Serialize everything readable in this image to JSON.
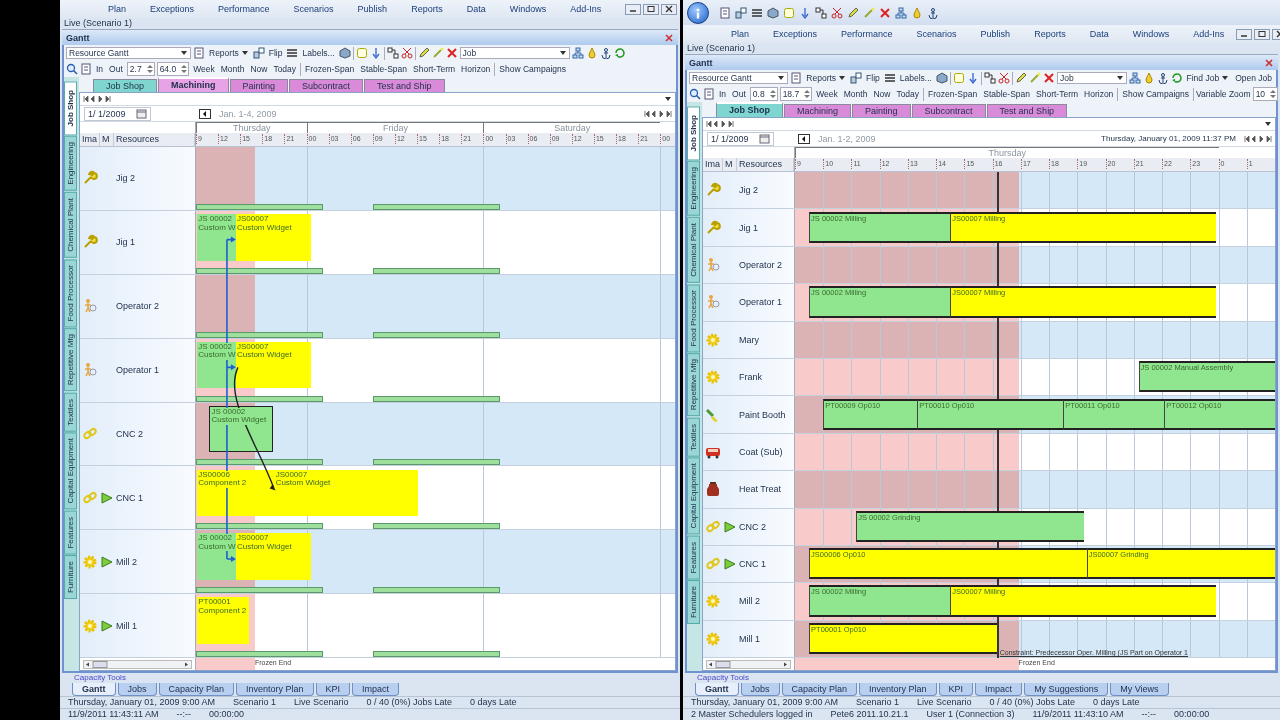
{
  "windows": [
    {
      "quick_access": false,
      "menu": [
        "Plan",
        "Exceptions",
        "Performance",
        "Scenarios",
        "Publish",
        "Reports",
        "Data",
        "Windows",
        "Add-Ins"
      ],
      "scenario": "Live (Scenario 1)",
      "panel_title": "Gantt",
      "toolbar": [
        [
          {
            "kind": "dropdown",
            "label": "Resource Gantt"
          },
          {
            "kind": "icon"
          },
          {
            "kind": "menu",
            "label": "Reports"
          },
          {
            "kind": "icon"
          },
          {
            "kind": "button",
            "label": "Flip"
          },
          {
            "kind": "icon"
          },
          {
            "kind": "button",
            "label": "Labels..."
          },
          {
            "kind": "icon"
          },
          {
            "kind": "sep"
          },
          {
            "kind": "icon"
          },
          {
            "kind": "icon"
          },
          {
            "kind": "sep"
          },
          {
            "kind": "icon"
          },
          {
            "kind": "icon"
          },
          {
            "kind": "sep"
          },
          {
            "kind": "icon"
          },
          {
            "kind": "icon"
          },
          {
            "kind": "icon"
          },
          {
            "kind": "dropdown",
            "label": "Job"
          },
          {
            "kind": "icon"
          },
          {
            "kind": "icon"
          },
          {
            "kind": "icon"
          },
          {
            "kind": "icon"
          }
        ],
        [
          {
            "kind": "icon"
          },
          {
            "kind": "icon"
          },
          {
            "kind": "button",
            "label": "In"
          },
          {
            "kind": "button",
            "label": "Out"
          },
          {
            "kind": "spin",
            "label": "2.7"
          },
          {
            "kind": "spin",
            "label": "64.0"
          },
          {
            "kind": "button",
            "label": "Week"
          },
          {
            "kind": "button",
            "label": "Month"
          },
          {
            "kind": "button",
            "label": "Now"
          },
          {
            "kind": "button",
            "label": "Today"
          },
          {
            "kind": "sep"
          },
          {
            "kind": "button",
            "label": "Frozen-Span"
          },
          {
            "kind": "button",
            "label": "Stable-Span"
          },
          {
            "kind": "button",
            "label": "Short-Term"
          },
          {
            "kind": "button",
            "label": "Horizon"
          },
          {
            "kind": "sep"
          },
          {
            "kind": "button",
            "label": "Show Campaigns"
          }
        ]
      ],
      "tabs": [
        {
          "label": "Job Shop",
          "color": "#7fd6d0",
          "selected": false
        },
        {
          "label": "Machining",
          "color": "#e7a3e6",
          "selected": true
        },
        {
          "label": "Painting",
          "color": "#d98ad8",
          "selected": false
        },
        {
          "label": "Subcontract",
          "color": "#d98ad8",
          "selected": false
        },
        {
          "label": "Test and Ship",
          "color": "#d98ad8",
          "selected": false
        }
      ],
      "side_tabs": [
        {
          "label": "Job Shop",
          "selected": true
        },
        {
          "label": "Engineering",
          "selected": false
        },
        {
          "label": "Chemical Plant",
          "selected": false
        },
        {
          "label": "Food Processor",
          "selected": false
        },
        {
          "label": "Repetitive Mfg",
          "selected": false
        },
        {
          "label": "Textiles",
          "selected": false
        },
        {
          "label": "Capital Equipment",
          "selected": false
        },
        {
          "label": "Features",
          "selected": false
        },
        {
          "label": "Furniture",
          "selected": false
        }
      ],
      "gantt": {
        "date": "1/ 1/2009",
        "range": "Jan. 1-4, 2009",
        "columns": [
          "Ima",
          "M",
          "Resources"
        ],
        "days": [
          "Thursday",
          "Friday",
          "Saturday"
        ],
        "ticks": [
          "9",
          "12",
          "15",
          "18",
          "21",
          "00",
          "03",
          "06",
          "09",
          "12",
          "15",
          "18",
          "21",
          "00",
          "03",
          "06",
          "09",
          "12",
          "15",
          "18",
          "21",
          "00"
        ],
        "rows": [
          {
            "name": "Jig 2",
            "kind": "jig",
            "flag": false,
            "shaded": true,
            "bars": []
          },
          {
            "name": "Jig 1",
            "kind": "jig",
            "flag": false,
            "shaded": false,
            "bars": [
              {
                "lines": [
                  "JS 00002",
                  "Custom W"
                ],
                "color": "#8fe68f",
                "outlined": false,
                "kind": "plain"
              },
              {
                "lines": [
                  "JS00007",
                  "Custom Widget"
                ],
                "color": "#ffff00",
                "outlined": false,
                "kind": "elbow"
              }
            ]
          },
          {
            "name": "Operator 2",
            "kind": "operator",
            "flag": false,
            "shaded": true,
            "bars": []
          },
          {
            "name": "Operator 1",
            "kind": "operator",
            "flag": false,
            "shaded": false,
            "bars": [
              {
                "lines": [
                  "JS 00002",
                  "Custom W"
                ],
                "color": "#8fe68f",
                "outlined": false,
                "kind": "plain"
              },
              {
                "lines": [
                  "JS00007",
                  "Custom Widget"
                ],
                "color": "#ffff00",
                "outlined": false,
                "kind": "elbow"
              }
            ]
          },
          {
            "name": "CNC 2",
            "kind": "chain",
            "flag": false,
            "shaded": true,
            "bars": [
              {
                "lines": [
                  "JS 00002",
                  "Custom Widget"
                ],
                "color": "#8fe68f",
                "outlined": true,
                "kind": "plain"
              }
            ]
          },
          {
            "name": "CNC 1",
            "kind": "chain",
            "flag": true,
            "shaded": false,
            "bars": [
              {
                "lines": [
                  "JS00006",
                  "Component 2"
                ],
                "color": "#ffff00",
                "outlined": false,
                "kind": "plain"
              },
              {
                "lines": [
                  "JS00007",
                  "Custom Widget"
                ],
                "color": "#ffff00",
                "outlined": false,
                "kind": "curve"
              }
            ]
          },
          {
            "name": "Mill 2",
            "kind": "gear",
            "flag": true,
            "shaded": true,
            "bars": [
              {
                "lines": [
                  "JS 00002",
                  "Custom W"
                ],
                "color": "#8fe68f",
                "outlined": false,
                "kind": "plain"
              },
              {
                "lines": [
                  "JS00007",
                  "Custom Widget"
                ],
                "color": "#ffff00",
                "outlined": false,
                "kind": "elbow"
              }
            ]
          },
          {
            "name": "Mill 1",
            "kind": "gear",
            "flag": true,
            "shaded": false,
            "bars": [
              {
                "lines": [
                  "PT00001",
                  "Component 2"
                ],
                "color": "#ffff00",
                "outlined": false,
                "kind": "plain"
              }
            ]
          }
        ],
        "frozen_label": "Frozen End"
      },
      "tools_label": "Capacity Tools",
      "bottom_tabs": [
        {
          "label": "Gantt",
          "selected": true
        },
        {
          "label": "Jobs",
          "selected": false
        },
        {
          "label": "Capacity Plan",
          "selected": false
        },
        {
          "label": "Inventory Plan",
          "selected": false
        },
        {
          "label": "KPI",
          "selected": false
        },
        {
          "label": "Impact",
          "selected": false
        }
      ],
      "status": [
        [
          "Thursday, January 01, 2009 9:00 AM",
          "Scenario 1",
          "Live Scenario",
          "0 / 40 (0%) Jobs Late",
          "0 days Late"
        ],
        [
          "11/9/2011 11:43:11 AM",
          "--:--",
          "00:00:00"
        ]
      ]
    },
    {
      "quick_access": true,
      "menu": [
        "Plan",
        "Exceptions",
        "Performance",
        "Scenarios",
        "Publish",
        "Reports",
        "Data",
        "Windows",
        "Add-Ins"
      ],
      "scenario": "Live (Scenario 1)",
      "panel_title": "Gantt",
      "toolbar": [
        [
          {
            "kind": "dropdown",
            "label": "Resource Gantt"
          },
          {
            "kind": "icon"
          },
          {
            "kind": "menu",
            "label": "Reports"
          },
          {
            "kind": "icon"
          },
          {
            "kind": "button",
            "label": "Flip"
          },
          {
            "kind": "icon"
          },
          {
            "kind": "button",
            "label": "Labels..."
          },
          {
            "kind": "icon"
          },
          {
            "kind": "sep"
          },
          {
            "kind": "icon"
          },
          {
            "kind": "icon"
          },
          {
            "kind": "sep"
          },
          {
            "kind": "icon"
          },
          {
            "kind": "icon"
          },
          {
            "kind": "sep"
          },
          {
            "kind": "icon"
          },
          {
            "kind": "icon"
          },
          {
            "kind": "icon"
          },
          {
            "kind": "dropdown",
            "label": "Job"
          },
          {
            "kind": "icon"
          },
          {
            "kind": "icon"
          },
          {
            "kind": "icon"
          },
          {
            "kind": "icon"
          },
          {
            "kind": "menu",
            "label": "Find Job"
          },
          {
            "kind": "button",
            "label": "Open Job"
          }
        ],
        [
          {
            "kind": "icon"
          },
          {
            "kind": "icon"
          },
          {
            "kind": "button",
            "label": "In"
          },
          {
            "kind": "button",
            "label": "Out"
          },
          {
            "kind": "spin",
            "label": "0.8"
          },
          {
            "kind": "spin",
            "label": "18.7"
          },
          {
            "kind": "button",
            "label": "Week"
          },
          {
            "kind": "button",
            "label": "Month"
          },
          {
            "kind": "button",
            "label": "Now"
          },
          {
            "kind": "button",
            "label": "Today"
          },
          {
            "kind": "sep"
          },
          {
            "kind": "button",
            "label": "Frozen-Span"
          },
          {
            "kind": "button",
            "label": "Stable-Span"
          },
          {
            "kind": "button",
            "label": "Short-Term"
          },
          {
            "kind": "button",
            "label": "Horizon"
          },
          {
            "kind": "sep"
          },
          {
            "kind": "button",
            "label": "Show Campaigns"
          },
          {
            "kind": "sep"
          },
          {
            "kind": "text",
            "label": "Variable Zoom"
          },
          {
            "kind": "spin",
            "label": "10"
          }
        ]
      ],
      "tabs": [
        {
          "label": "Job Shop",
          "color": "#7fd6d0",
          "selected": true
        },
        {
          "label": "Machining",
          "color": "#d98ad8",
          "selected": false
        },
        {
          "label": "Painting",
          "color": "#d98ad8",
          "selected": false
        },
        {
          "label": "Subcontract",
          "color": "#d98ad8",
          "selected": false
        },
        {
          "label": "Test and Ship",
          "color": "#d98ad8",
          "selected": false
        }
      ],
      "side_tabs": [
        {
          "label": "Job Shop",
          "selected": true
        },
        {
          "label": "Engineering",
          "selected": false
        },
        {
          "label": "Chemical Plant",
          "selected": false
        },
        {
          "label": "Food Processor",
          "selected": false
        },
        {
          "label": "Repetitive Mfg",
          "selected": false
        },
        {
          "label": "Textiles",
          "selected": false
        },
        {
          "label": "Capital Equipment",
          "selected": false
        },
        {
          "label": "Features",
          "selected": false
        },
        {
          "label": "Furniture",
          "selected": false
        }
      ],
      "gantt": {
        "date": "1/ 1/2009",
        "range": "Jan. 1-2, 2009",
        "stamp": "Thursday, January 01, 2009 11:37 PM",
        "columns": [
          "Ima",
          "M",
          "Resources"
        ],
        "days": [
          "Thursday"
        ],
        "ticks": [
          "9",
          "10",
          "11",
          "12",
          "13",
          "14",
          "15",
          "16",
          "17",
          "18",
          "19",
          "20",
          "21",
          "22",
          "23",
          "0",
          "1"
        ],
        "rows": [
          {
            "name": "Jig 2",
            "kind": "jig",
            "flag": false,
            "shaded": true,
            "bars": []
          },
          {
            "name": "Jig 1",
            "kind": "jig",
            "flag": false,
            "shaded": false,
            "bars": [
              {
                "lines": [
                  "JS 00002 Milling"
                ],
                "color": "#8fe68f",
                "outlined": true
              },
              {
                "lines": [
                  "JS00007 Milling"
                ],
                "color": "#ffff00",
                "outlined": true
              }
            ]
          },
          {
            "name": "Operator 2",
            "kind": "operator",
            "flag": false,
            "shaded": true,
            "bars": []
          },
          {
            "name": "Operator 1",
            "kind": "operator",
            "flag": false,
            "shaded": false,
            "bars": [
              {
                "lines": [
                  "JS 00002 Milling"
                ],
                "color": "#8fe68f",
                "outlined": true
              },
              {
                "lines": [
                  "JS00007 Milling"
                ],
                "color": "#ffff00",
                "outlined": true
              }
            ]
          },
          {
            "name": "Mary",
            "kind": "gear",
            "flag": false,
            "shaded": true,
            "bars": []
          },
          {
            "name": "Frank",
            "kind": "gear",
            "flag": false,
            "shaded": false,
            "bars": [
              {
                "lines": [
                  "JS 00002 Manual Assembly"
                ],
                "color": "#8fe68f",
                "outlined": true
              }
            ]
          },
          {
            "name": "Paint Booth",
            "kind": "brush",
            "flag": false,
            "shaded": true,
            "bars": [
              {
                "lines": [
                  "PT00009 Op010"
                ],
                "color": "#8fe68f",
                "outlined": true
              },
              {
                "lines": [
                  "PT00010 Op010"
                ],
                "color": "#8fe68f",
                "outlined": true
              },
              {
                "lines": [
                  "PT00011 Op010"
                ],
                "color": "#8fe68f",
                "outlined": true
              },
              {
                "lines": [
                  "PT00012 Op010"
                ],
                "color": "#8fe68f",
                "outlined": true
              }
            ]
          },
          {
            "name": "Coat (Sub)",
            "kind": "van",
            "flag": false,
            "shaded": false,
            "bars": []
          },
          {
            "name": "Heat Treat",
            "kind": "jar",
            "flag": false,
            "shaded": true,
            "bars": []
          },
          {
            "name": "CNC 2",
            "kind": "chain",
            "flag": true,
            "shaded": false,
            "bars": [
              {
                "lines": [
                  "JS 00002 Grinding"
                ],
                "color": "#8fe68f",
                "outlined": true
              }
            ]
          },
          {
            "name": "CNC 1",
            "kind": "chain",
            "flag": true,
            "shaded": true,
            "bars": [
              {
                "lines": [
                  "JS00006 Op010"
                ],
                "color": "#ffff00",
                "outlined": true
              },
              {
                "lines": [
                  "JS00007 Grinding"
                ],
                "color": "#ffff00",
                "outlined": true
              }
            ]
          },
          {
            "name": "Mill 2",
            "kind": "gear",
            "flag": false,
            "shaded": false,
            "bars": [
              {
                "lines": [
                  "JS 00002 Milling"
                ],
                "color": "#8fe68f",
                "outlined": true
              },
              {
                "lines": [
                  "JS00007 Milling"
                ],
                "color": "#ffff00",
                "outlined": true
              }
            ]
          },
          {
            "name": "Mill 1",
            "kind": "gear",
            "flag": false,
            "shaded": true,
            "bars": [
              {
                "lines": [
                  "PT00001 Op010"
                ],
                "color": "#ffff00",
                "outlined": true
              }
            ],
            "note": "Constraint: Predecessor Oper. Milling (JS Part on Operator 1"
          }
        ],
        "frozen_label": "Frozen End"
      },
      "tools_label": "Capacity Tools",
      "bottom_tabs": [
        {
          "label": "Gantt",
          "selected": true
        },
        {
          "label": "Jobs",
          "selected": false
        },
        {
          "label": "Capacity Plan",
          "selected": false
        },
        {
          "label": "Inventory Plan",
          "selected": false
        },
        {
          "label": "KPI",
          "selected": false
        },
        {
          "label": "Impact",
          "selected": false
        },
        {
          "label": "My Suggestions",
          "selected": false
        },
        {
          "label": "My Views",
          "selected": false
        }
      ],
      "status": [
        [
          "Thursday, January 01, 2009 9:00 AM",
          "Scenario 1",
          "Live Scenario",
          "0 / 40 (0%) Jobs Late",
          "0 days Late"
        ],
        [
          "2 Master Schedulers logged in",
          "Pete6 2011.10.21.1",
          "User 1 (Connection 3)",
          "11/9/2011 11:43:10 AM",
          "--:--",
          "00:00:00"
        ]
      ]
    }
  ]
}
